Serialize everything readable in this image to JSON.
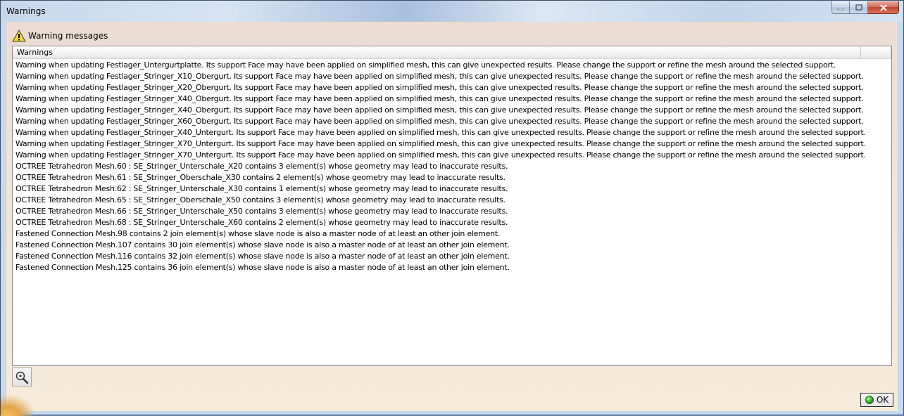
{
  "window": {
    "title": "Warnings"
  },
  "panel": {
    "header_label": "Warning messages",
    "column_header": "Warnings",
    "column_header_2": ""
  },
  "messages": [
    "Warning when updating Festlager_Untergurtplatte. Its support Face may have been applied on simplified mesh, this can give unexpected results. Please change the support or refine the mesh around the selected support.",
    "Warning when updating Festlager_Stringer_X10_Obergurt. Its support Face may have been applied on simplified mesh, this can give unexpected results. Please change the support or refine the mesh around the selected support.",
    "Warning when updating Festlager_Stringer_X20_Obergurt. Its support Face may have been applied on simplified mesh, this can give unexpected results. Please change the support or refine the mesh around the selected support.",
    "Warning when updating Festlager_Stringer_X40_Obergurt. Its support Face may have been applied on simplified mesh, this can give unexpected results. Please change the support or refine the mesh around the selected support.",
    "Warning when updating Festlager_Stringer_X40_Obergurt. Its support Face may have been applied on simplified mesh, this can give unexpected results. Please change the support or refine the mesh around the selected support.",
    "Warning when updating Festlager_Stringer_X60_Obergurt. Its support Face may have been applied on simplified mesh, this can give unexpected results. Please change the support or refine the mesh around the selected support.",
    "Warning when updating Festlager_Stringer_X40_Untergurt. Its support Face may have been applied on simplified mesh, this can give unexpected results. Please change the support or refine the mesh around the selected support.",
    "Warning when updating Festlager_Stringer_X70_Untergurt. Its support Face may have been applied on simplified mesh, this can give unexpected results. Please change the support or refine the mesh around the selected support.",
    "Warning when updating Festlager_Stringer_X70_Untergurt. Its support Face may have been applied on simplified mesh, this can give unexpected results. Please change the support or refine the mesh around the selected support.",
    "OCTREE Tetrahedron Mesh.60 : SE_Stringer_Unterschale_X20 contains 3 element(s) whose geometry may lead to inaccurate results.",
    "OCTREE Tetrahedron Mesh.61 : SE_Stringer_Oberschale_X30 contains 2 element(s) whose geometry may lead to inaccurate results.",
    "OCTREE Tetrahedron Mesh.62 : SE_Stringer_Unterschale_X30 contains 1 element(s) whose geometry may lead to inaccurate results.",
    "OCTREE Tetrahedron Mesh.65 : SE_Stringer_Oberschale_X50 contains 3 element(s) whose geometry may lead to inaccurate results.",
    "OCTREE Tetrahedron Mesh.66 : SE_Stringer_Unterschale_X50 contains 3 element(s) whose geometry may lead to inaccurate results.",
    "OCTREE Tetrahedron Mesh.68 : SE_Stringer_Unterschale_X60 contains 2 element(s) whose geometry may lead to inaccurate results.",
    "Fastened Connection Mesh.98 contains 2 join element(s) whose slave node is also a master node of at least an other join element.",
    "Fastened Connection Mesh.107 contains 30 join element(s) whose slave node is also a master node of at least an other join element.",
    "Fastened Connection Mesh.116 contains 32 join element(s) whose slave node is also a master node of at least an other join element.",
    "Fastened Connection Mesh.125 contains 36 join element(s) whose slave node is also a master node of at least an other join element."
  ],
  "buttons": {
    "ok_label": "OK"
  },
  "icons": {
    "warning": "warning-triangle-icon",
    "zoom": "magnifier-icon",
    "ok": "green-dot-icon"
  },
  "colors": {
    "warning_fill": "#f7d629",
    "ok_green": "#41b82b",
    "close_red": "#c2432c"
  }
}
